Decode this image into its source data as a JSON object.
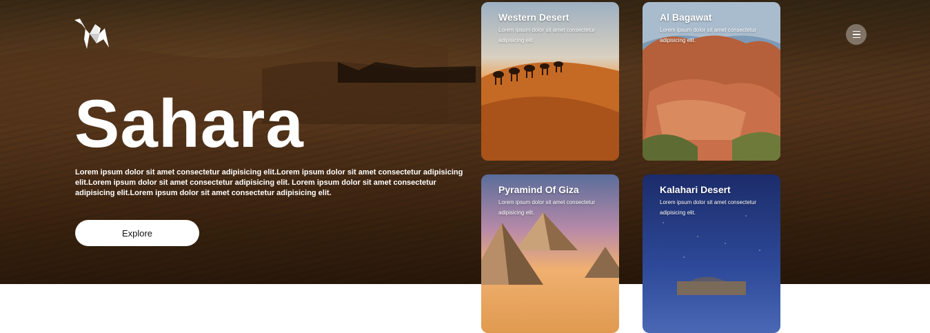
{
  "hero": {
    "title": "Sahara",
    "description": "Lorem ipsum dolor sit amet consectetur adipisicing elit.Lorem ipsum dolor sit amet consectetur adipisicing elit.Lorem ipsum dolor sit amet consectetur adipisicing elit. Lorem ipsum dolor sit amet consectetur adipisicing elit.Lorem ipsum dolor sit amet consectetur adipisicing elit.",
    "button_label": "Explore"
  },
  "nav": {
    "logo_icon": "origami-camel-icon",
    "menu_icon": "hamburger-menu-icon"
  },
  "cards": [
    {
      "title": "Western Desert",
      "description": "Lorem ipsum dolor sit amet consectetur adipisicing elit."
    },
    {
      "title": "Al Bagawat",
      "description": "Lorem ipsum dolor sit amet consectetur adipisicing elit."
    },
    {
      "title": "Pyramind Of Giza",
      "description": "Lorem ipsum dolor sit amet consectetur adipisicing elit."
    },
    {
      "title": "Kalahari Desert",
      "description": "Lorem ipsum dolor sit amet consectetur adipisicing elit."
    }
  ],
  "colors": {
    "background": "#4a2f18",
    "button_bg": "#ffffff",
    "text": "#ffffff"
  }
}
